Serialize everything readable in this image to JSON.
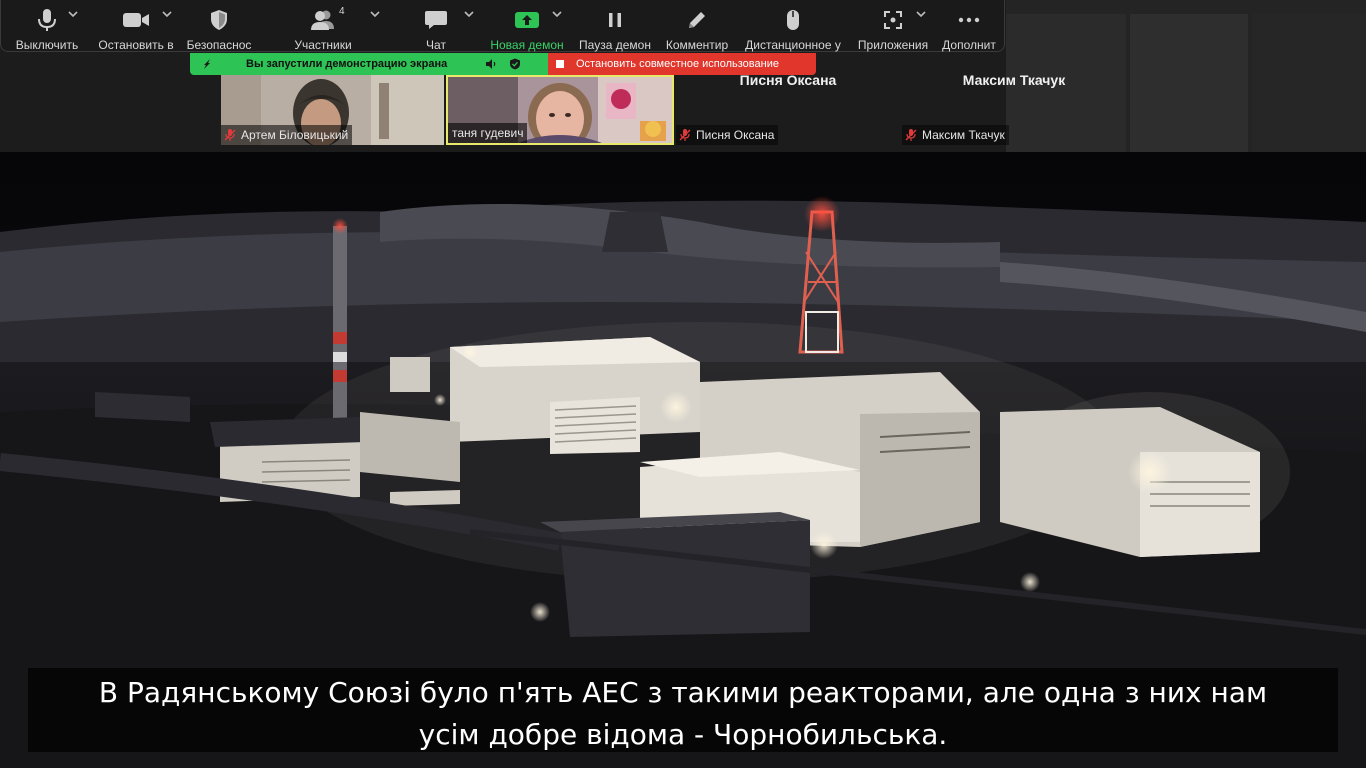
{
  "toolbar": {
    "mute_label": "Выключить",
    "video_label": "Остановить в",
    "security_label": "Безопаснос",
    "participants_label": "Участники",
    "participants_count": "4",
    "chat_label": "Чат",
    "new_share_label": "Новая демон",
    "pause_share_label": "Пауза демон",
    "annotate_label": "Комментир",
    "remote_control_label": "Дистанционное у",
    "apps_label": "Приложения",
    "more_label": "Дополнит"
  },
  "share_bar": {
    "sharing_text": "Вы запустили демонстрацию экрана",
    "stop_text": "Остановить совместное использование"
  },
  "participants": [
    {
      "name": "Артем Біловицький",
      "muted": true,
      "video_on": true
    },
    {
      "name": "таня гудевич",
      "muted": false,
      "video_on": true,
      "active_speaker": true
    },
    {
      "name": "Писня Оксана",
      "muted": true,
      "video_on": false
    },
    {
      "name": "Максим Ткачук",
      "muted": true,
      "video_on": false
    }
  ],
  "shared_content": {
    "subtitle_line1": "В Радянському Союзі було п'ять АЕС з такими реакторами, але одна з них нам",
    "subtitle_line2": "усім добре відома - Чорнобильська."
  },
  "colors": {
    "share_green": "#2ec455",
    "share_red": "#e0362c",
    "toolbar_bg": "#1a1a1a",
    "active_speaker_border": "#e8e86a"
  }
}
